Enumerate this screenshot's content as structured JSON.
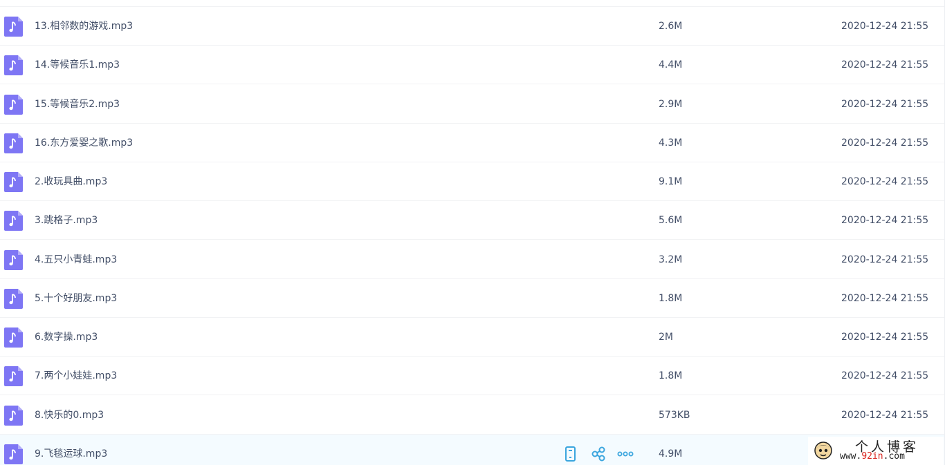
{
  "colors": {
    "icon_purple": "#7e76f4",
    "text": "#424e67",
    "action_blue": "#3aa5de",
    "active_row_bg": "#f4fbff",
    "watermark_red": "#d9221c"
  },
  "files": [
    {
      "name": "13.相邻数的游戏.mp3",
      "size": "2.6M",
      "date": "2020-12-24 21:55",
      "icon": "music-file-icon"
    },
    {
      "name": "14.等候音乐1.mp3",
      "size": "4.4M",
      "date": "2020-12-24 21:55",
      "icon": "music-file-icon"
    },
    {
      "name": "15.等候音乐2.mp3",
      "size": "2.9M",
      "date": "2020-12-24 21:55",
      "icon": "music-file-icon"
    },
    {
      "name": "16.东方爱婴之歌.mp3",
      "size": "4.3M",
      "date": "2020-12-24 21:55",
      "icon": "music-file-icon"
    },
    {
      "name": "2.收玩具曲.mp3",
      "size": "9.1M",
      "date": "2020-12-24 21:55",
      "icon": "music-file-icon"
    },
    {
      "name": "3.跳格子.mp3",
      "size": "5.6M",
      "date": "2020-12-24 21:55",
      "icon": "music-file-icon"
    },
    {
      "name": "4.五只小青蛙.mp3",
      "size": "3.2M",
      "date": "2020-12-24 21:55",
      "icon": "music-file-icon"
    },
    {
      "name": "5.十个好朋友.mp3",
      "size": "1.8M",
      "date": "2020-12-24 21:55",
      "icon": "music-file-icon"
    },
    {
      "name": "6.数字操.mp3",
      "size": "2M",
      "date": "2020-12-24 21:55",
      "icon": "music-file-icon"
    },
    {
      "name": "7.两个小娃娃.mp3",
      "size": "1.8M",
      "date": "2020-12-24 21:55",
      "icon": "music-file-icon"
    },
    {
      "name": "8.快乐的0.mp3",
      "size": "573KB",
      "date": "2020-12-24 21:55",
      "icon": "music-file-icon"
    },
    {
      "name": "9.飞毯运球.mp3",
      "size": "4.9M",
      "date": "",
      "icon": "music-file-icon",
      "active": true
    }
  ],
  "row_actions": [
    {
      "icon": "phone-icon",
      "label": "send-to-phone"
    },
    {
      "icon": "share-icon",
      "label": "share"
    },
    {
      "icon": "more-icon",
      "label": "more"
    }
  ],
  "watermark": {
    "title": "个人博客",
    "url_prefix": "www.",
    "url_highlight": "92in",
    "url_suffix": ".com"
  }
}
